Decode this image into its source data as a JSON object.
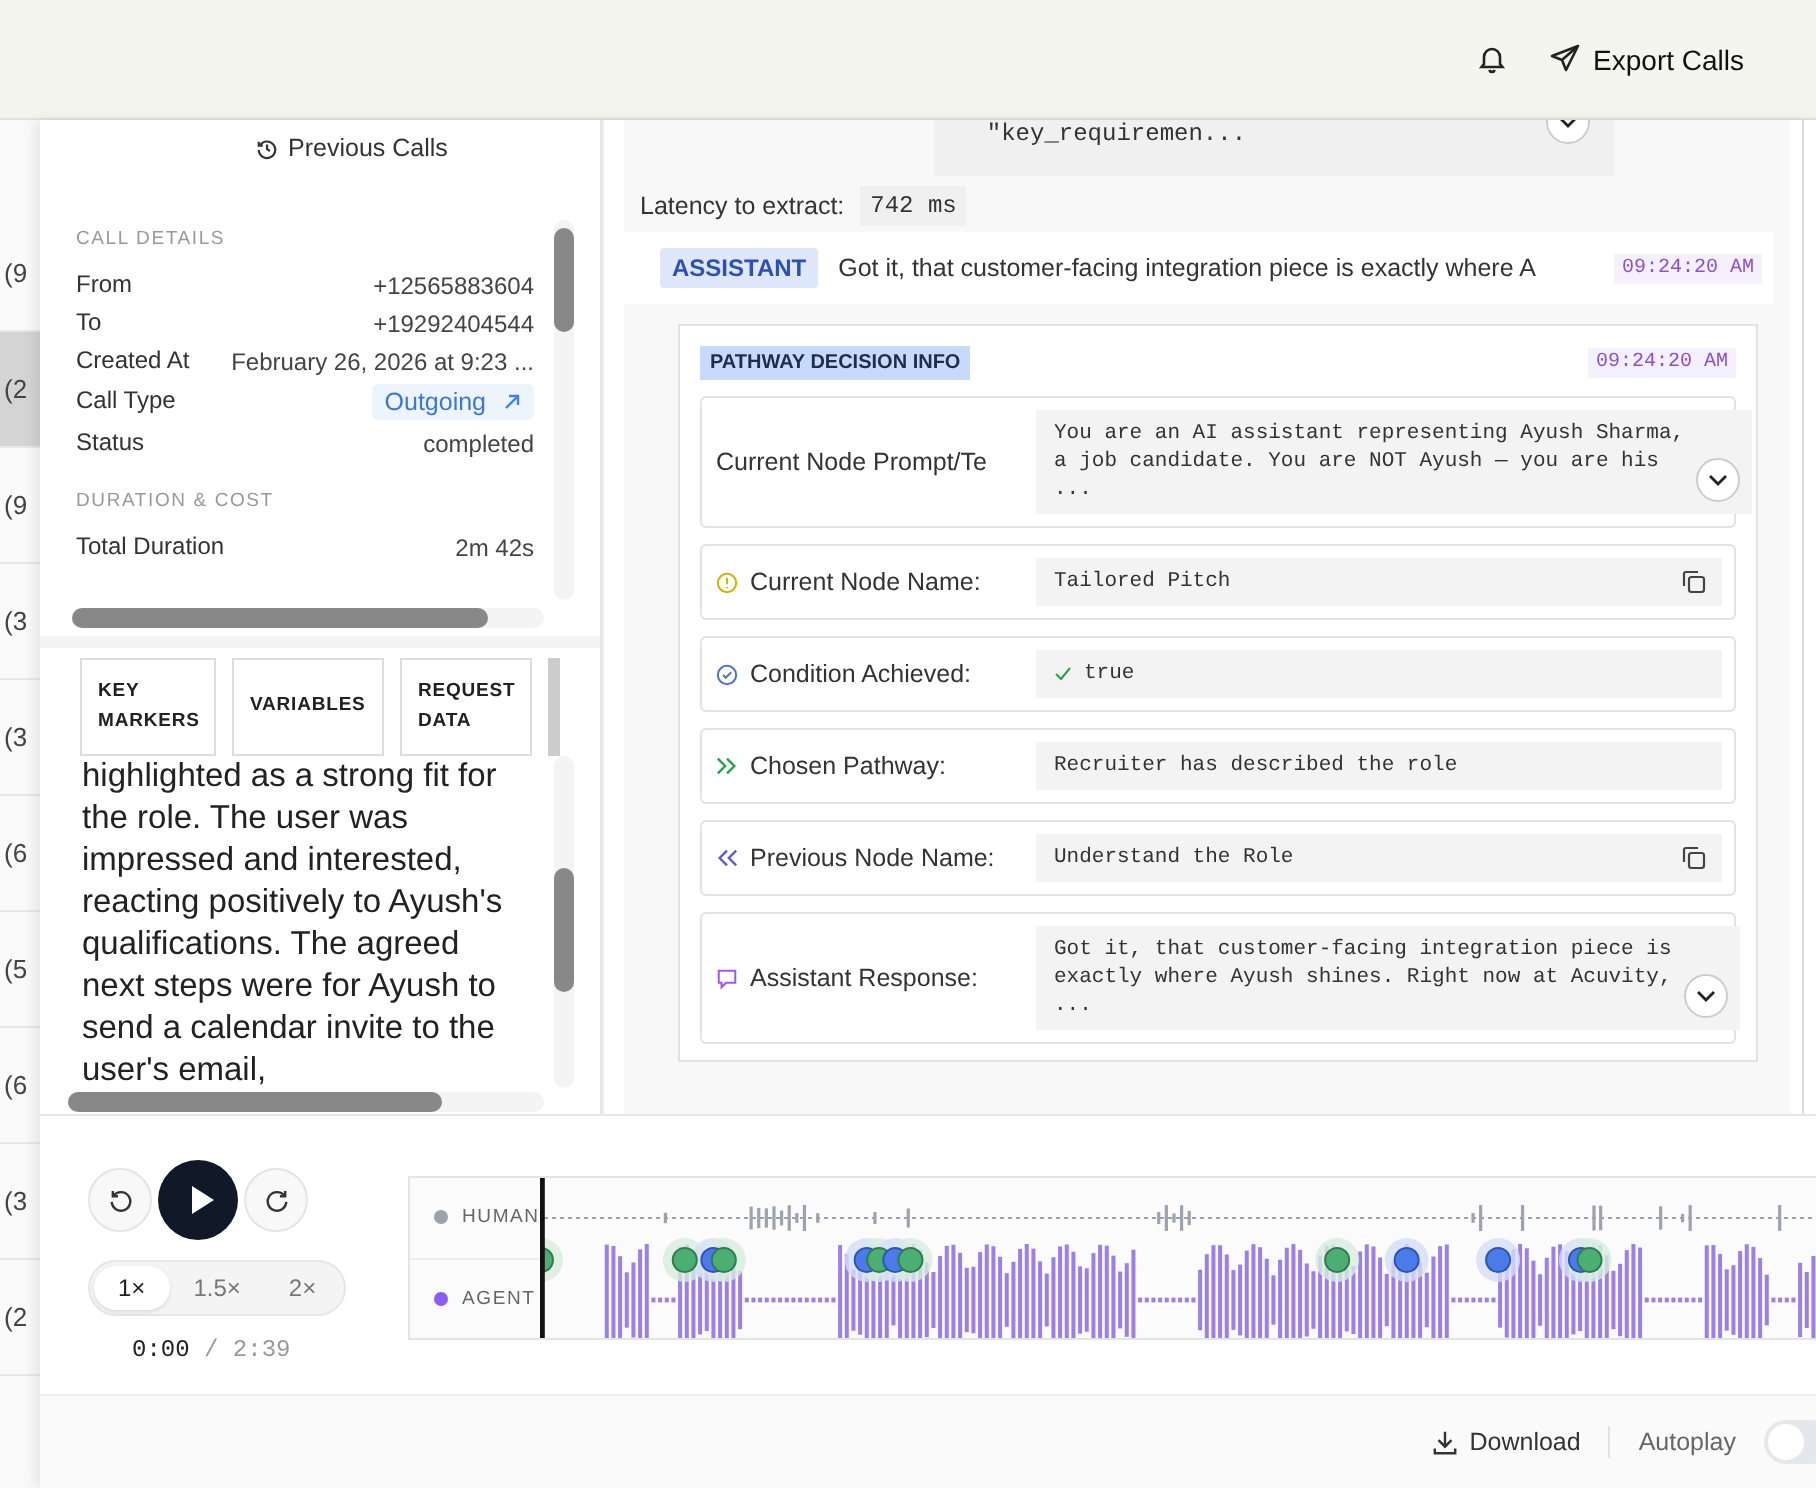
{
  "header": {
    "export_label": "Export Calls"
  },
  "background_rows": [
    {
      "text": "(9",
      "selected": false
    },
    {
      "text": "(2",
      "selected": true
    },
    {
      "text": "(9",
      "selected": false
    },
    {
      "text": "(3",
      "selected": false
    },
    {
      "text": "(3",
      "selected": false
    },
    {
      "text": "(6",
      "selected": false
    },
    {
      "text": "(5",
      "selected": false
    },
    {
      "text": "(6",
      "selected": false
    },
    {
      "text": "(3",
      "selected": false
    },
    {
      "text": "(2",
      "selected": false
    }
  ],
  "sidebar": {
    "previous_calls": "Previous Calls",
    "sections": [
      {
        "title": "CALL DETAILS",
        "rows": [
          {
            "label": "From",
            "value": "+12565883604",
            "kind": "text"
          },
          {
            "label": "To",
            "value": "+19292404544",
            "kind": "text"
          },
          {
            "label": "Created At",
            "value": "February 26, 2026 at 9:23 ...",
            "kind": "text"
          },
          {
            "label": "Call Type",
            "value": "Outgoing",
            "kind": "badge"
          },
          {
            "label": "Status",
            "value": "completed",
            "kind": "text"
          }
        ]
      },
      {
        "title": "DURATION & COST",
        "rows": [
          {
            "label": "Total Duration",
            "value": "2m 42s",
            "kind": "text"
          }
        ]
      }
    ],
    "tabs": [
      {
        "label": "KEY MARKERS"
      },
      {
        "label": "VARIABLES"
      },
      {
        "label": "REQUEST DATA"
      }
    ],
    "summary": "highlighted as a strong fit for the role. The user was impressed and interested, reacting positively to Ayush's qualifications. The agreed next steps were for Ayush to send a calendar invite to the user's email,"
  },
  "transcript": {
    "code_tail": "  \"key_requiremen...",
    "latency_label": "Latency to extract:",
    "latency_value": "742 ms",
    "message": {
      "role": "ASSISTANT",
      "text": "Got it, that customer-facing integration piece is exactly where A",
      "time": "09:24:20 AM"
    },
    "decision": {
      "title": "PATHWAY DECISION INFO",
      "time": "09:24:20 AM",
      "fields": [
        {
          "kind": "prompt",
          "label": "Current Node Prompt/Te",
          "value": "You are an AI assistant representing Ayush Sharma,\na job candidate. You are NOT Ayush — you are his\n...",
          "copyable": false,
          "expandable": true
        },
        {
          "kind": "name",
          "label": "Current Node Name:",
          "value": "Tailored Pitch",
          "copyable": true,
          "expandable": false
        },
        {
          "kind": "condition",
          "label": "Condition Achieved:",
          "value": "true",
          "copyable": false,
          "expandable": false
        },
        {
          "kind": "pathway",
          "label": "Chosen Pathway:",
          "value": "Recruiter has described the role",
          "copyable": false,
          "expandable": false
        },
        {
          "kind": "previous",
          "label": "Previous Node Name:",
          "value": "Understand the Role",
          "copyable": true,
          "expandable": false
        },
        {
          "kind": "response",
          "label": "Assistant Response:",
          "value": "Got it, that customer-facing integration piece is\nexactly where Ayush shines. Right now at Acuvity,\n...",
          "copyable": false,
          "expandable": true
        }
      ]
    }
  },
  "player": {
    "speeds": [
      {
        "label": "1×",
        "selected": true
      },
      {
        "label": "1.5×",
        "selected": false
      },
      {
        "label": "2×",
        "selected": false
      }
    ],
    "current": "0:00",
    "total": "/ 2:39",
    "tracks": [
      {
        "label": "HUMAN",
        "color": "#9ca3af"
      },
      {
        "label": "AGENT",
        "color": "#8b5cf6"
      }
    ],
    "download": "Download",
    "autoplay_label": "Autoplay",
    "autoplay_on": false
  }
}
